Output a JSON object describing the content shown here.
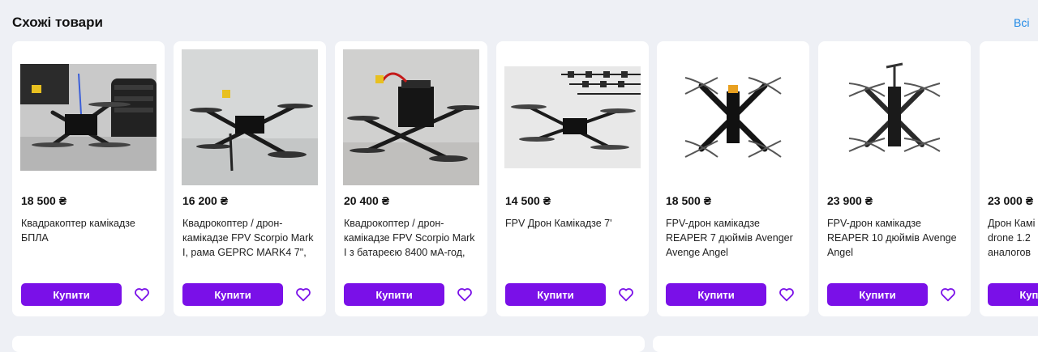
{
  "section": {
    "title": "Схожі товари",
    "all_label": "Всі"
  },
  "colors": {
    "accent": "#7a10e8",
    "link": "#1e88e5",
    "background": "#eef0f5"
  },
  "products": [
    {
      "price": "18 500 ₴",
      "name": "Квадракоптер камікадзе БПЛА",
      "buy_label": "Купити",
      "icon": "drone-photo"
    },
    {
      "price": "16 200 ₴",
      "name": "Квадрокоптер / дрон-камікадзе FPV Scorpio Mark I, рама GEPRC MARK4 7\",",
      "buy_label": "Купити",
      "icon": "drone-photo"
    },
    {
      "price": "20 400 ₴",
      "name": "Квадрокоптер / дрон-камікадзе FPV Scorpio Mark I з батареєю 8400 мА-год,",
      "buy_label": "Купити",
      "icon": "drone-photo"
    },
    {
      "price": "14 500 ₴",
      "name": "FPV Дрон Камікадзе 7'",
      "buy_label": "Купити",
      "icon": "drone-photo"
    },
    {
      "price": "18 500 ₴",
      "name": "FPV-дрон камікадзе REAPER 7 дюймів Avenger Avenge Angel",
      "buy_label": "Купити",
      "icon": "drone-photo"
    },
    {
      "price": "23 900 ₴",
      "name": "FPV-дрон камікадзе REAPER 10 дюймів Avenge Angel",
      "buy_label": "Купити",
      "icon": "drone-photo"
    },
    {
      "price": "23 000 ₴",
      "name": "Дрон Камі drone 1.2 аналогов",
      "buy_label": "Купити",
      "icon": "drone-photo"
    }
  ]
}
